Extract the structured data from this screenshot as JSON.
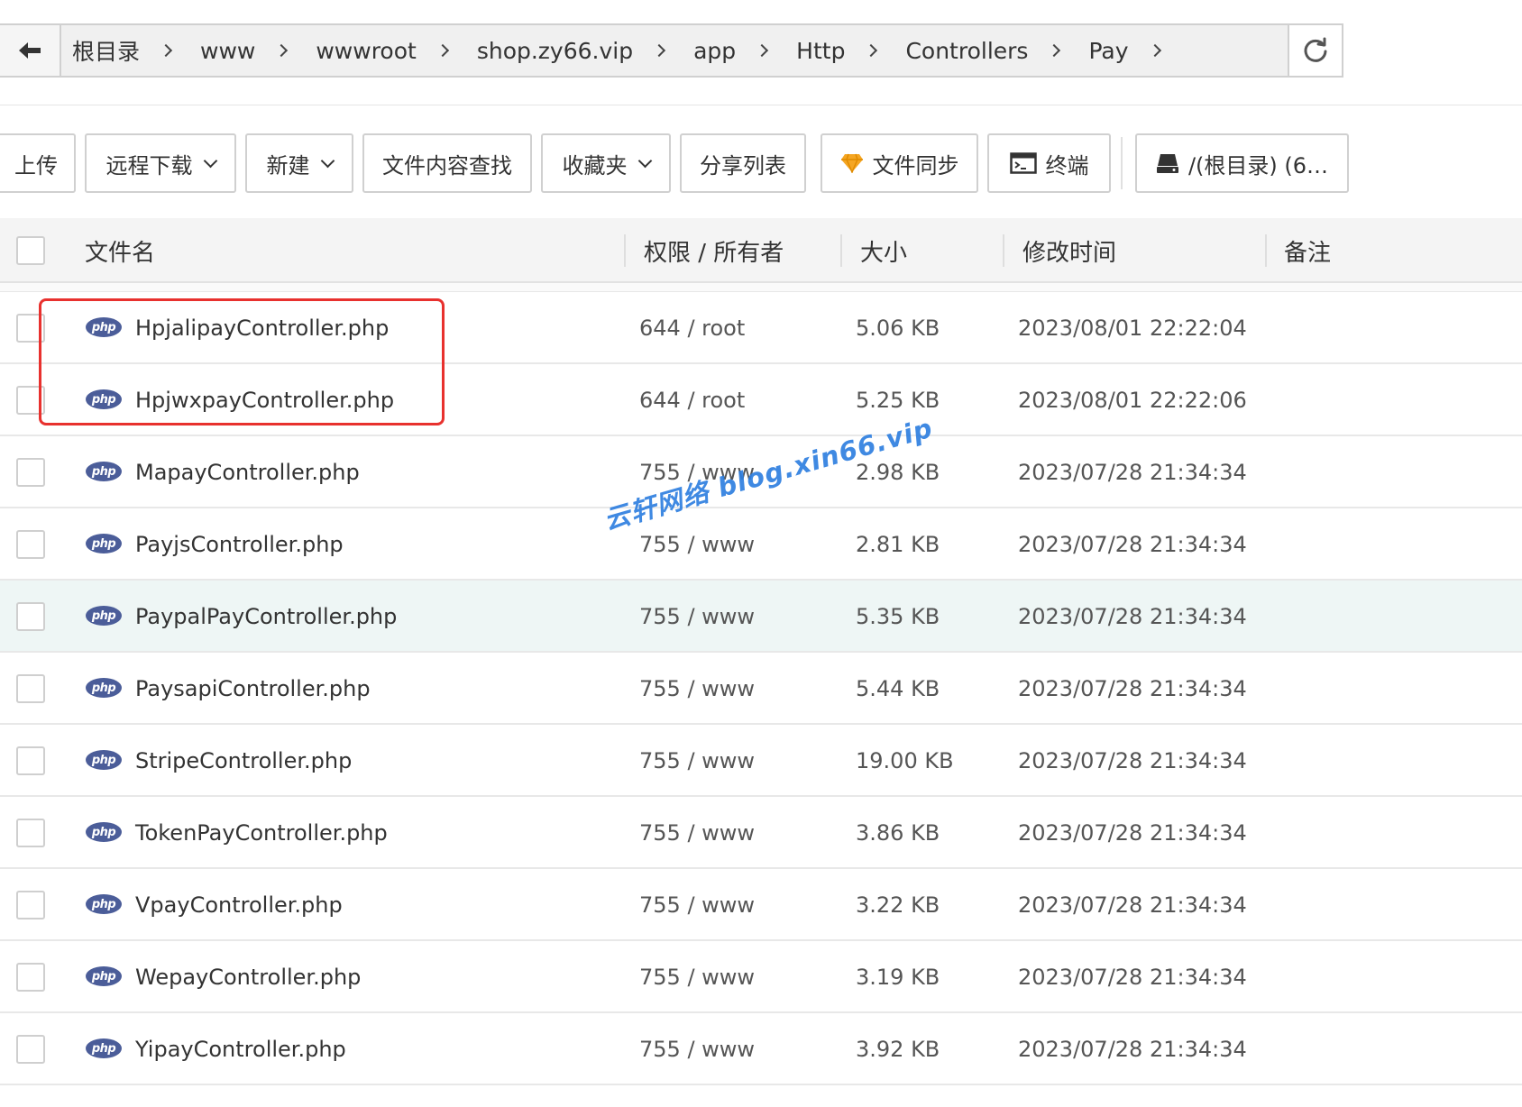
{
  "pathbar": {
    "crumbs": [
      "根目录",
      "www",
      "wwwroot",
      "shop.zy66.vip",
      "app",
      "Http",
      "Controllers",
      "Pay"
    ]
  },
  "toolbar": {
    "upload_label": "上传",
    "remote_download_label": "远程下载",
    "new_label": "新建",
    "content_search_label": "文件内容查找",
    "favorites_label": "收藏夹",
    "share_list_label": "分享列表",
    "file_sync_label": "文件同步",
    "terminal_label": "终端",
    "disk_label": "/(根目录) (6…"
  },
  "table": {
    "headers": {
      "name": "文件名",
      "perm": "权限 / 所有者",
      "size": "大小",
      "mtime": "修改时间",
      "note": "备注"
    },
    "rows": [
      {
        "name": "HpjalipayController.php",
        "perm": "644 / root",
        "size": "5.06 KB",
        "mtime": "2023/08/01 22:22:04"
      },
      {
        "name": "HpjwxpayController.php",
        "perm": "644 / root",
        "size": "5.25 KB",
        "mtime": "2023/08/01 22:22:06"
      },
      {
        "name": "MapayController.php",
        "perm": "755 / www",
        "size": "2.98 KB",
        "mtime": "2023/07/28 21:34:34"
      },
      {
        "name": "PayjsController.php",
        "perm": "755 / www",
        "size": "2.81 KB",
        "mtime": "2023/07/28 21:34:34"
      },
      {
        "name": "PaypalPayController.php",
        "perm": "755 / www",
        "size": "5.35 KB",
        "mtime": "2023/07/28 21:34:34"
      },
      {
        "name": "PaysapiController.php",
        "perm": "755 / www",
        "size": "5.44 KB",
        "mtime": "2023/07/28 21:34:34"
      },
      {
        "name": "StripeController.php",
        "perm": "755 / www",
        "size": "19.00 KB",
        "mtime": "2023/07/28 21:34:34"
      },
      {
        "name": "TokenPayController.php",
        "perm": "755 / www",
        "size": "3.86 KB",
        "mtime": "2023/07/28 21:34:34"
      },
      {
        "name": "VpayController.php",
        "perm": "755 / www",
        "size": "3.22 KB",
        "mtime": "2023/07/28 21:34:34"
      },
      {
        "name": "WepayController.php",
        "perm": "755 / www",
        "size": "3.19 KB",
        "mtime": "2023/07/28 21:34:34"
      },
      {
        "name": "YipayController.php",
        "perm": "755 / www",
        "size": "3.92 KB",
        "mtime": "2023/07/28 21:34:34"
      }
    ],
    "file_icon_text": "php"
  },
  "watermark": "云轩网络 blog.xin66.vip",
  "colors": {
    "highlight": "#e8312e",
    "watermark": "#2f7fe0",
    "php_icon": "#4b5d99",
    "hover_row": "#eef6f5"
  },
  "icons": [
    "back-arrow-icon",
    "chevron-right-icon",
    "refresh-icon",
    "chevron-down-icon",
    "diamond-icon",
    "terminal-icon",
    "disk-icon",
    "php-file-icon"
  ]
}
